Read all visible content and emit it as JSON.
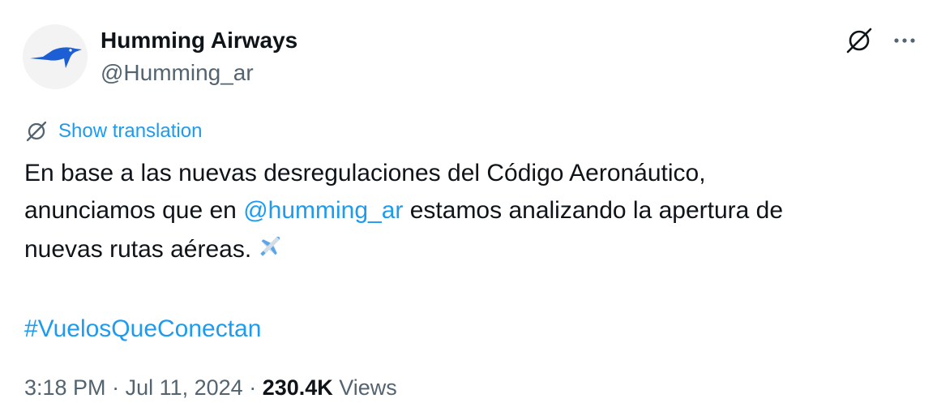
{
  "author": {
    "display_name": "Humming Airways",
    "handle": "@Humming_ar",
    "avatar_icon": "hummingbird-logo",
    "brand_color": "#1c5fd4"
  },
  "actions": {
    "grok_icon": "slash-circle-icon",
    "more_icon": "more-dots-icon"
  },
  "translation": {
    "label": "Show translation",
    "icon": "translate-slash-icon"
  },
  "content": {
    "line1": "En base a las nuevas desregulaciones del Código Aeronáutico,",
    "line2_before": "anunciamos que en ",
    "mention": "@humming_ar",
    "line2_after": " estamos analizando la apertura de",
    "line3": "nuevas rutas aéreas.",
    "emoji_icon": "airplane-emoji",
    "hashtag": "#VuelosQueConectan"
  },
  "meta": {
    "time": "3:18 PM",
    "separator1": " · ",
    "date": "Jul 11, 2024",
    "separator2": " · ",
    "views_count": "230.4K",
    "views_label": " Views"
  },
  "colors": {
    "link": "#1d9bf0",
    "secondary_text": "#536471",
    "primary_text": "#0f1419"
  }
}
